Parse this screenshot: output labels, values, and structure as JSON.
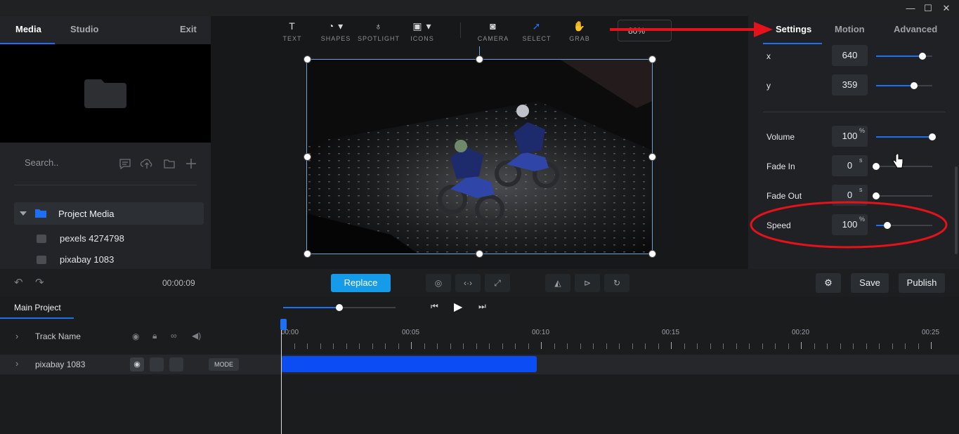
{
  "window": {
    "minimize": "—",
    "maximize": "☐",
    "close": "✕"
  },
  "left_panel": {
    "tabs": [
      "Media",
      "Studio"
    ],
    "exit_label": "Exit",
    "search_placeholder": "Search..",
    "folder_label": "Project Media",
    "media_items": [
      "pexels 4274798",
      "pixabay 1083"
    ],
    "time": "00:00:09"
  },
  "toolbar": {
    "tools": [
      {
        "label": "TEXT",
        "icon": "text-icon"
      },
      {
        "label": "SHAPES",
        "icon": "shapes-icon"
      },
      {
        "label": "SPOTLIGHT",
        "icon": "spotlight-icon"
      },
      {
        "label": "ICONS",
        "icon": "image-icon"
      },
      {
        "label": "CAMERA",
        "icon": "camera-icon"
      },
      {
        "label": "SELECT",
        "icon": "cursor-icon"
      },
      {
        "label": "GRAB",
        "icon": "hand-icon"
      }
    ],
    "zoom": "80%"
  },
  "right_panel": {
    "tabs": [
      "Settings",
      "Motion",
      "Advanced"
    ],
    "active_tab": "Settings",
    "params": [
      {
        "label": "x",
        "value": "640",
        "unit": "",
        "level": 0.82
      },
      {
        "label": "y",
        "value": "359",
        "unit": "",
        "level": 0.68
      },
      {
        "label": "Volume",
        "value": "100",
        "unit": "%",
        "level": 1.0
      },
      {
        "label": "Fade In",
        "value": "0",
        "unit": "s",
        "level": 0.0
      },
      {
        "label": "Fade Out",
        "value": "0",
        "unit": "s",
        "level": 0.0
      },
      {
        "label": "Speed",
        "value": "100",
        "unit": "%",
        "level": 0.2
      }
    ]
  },
  "actions": {
    "replace": "Replace",
    "save": "Save",
    "publish": "Publish"
  },
  "timeline": {
    "project_tab": "Main Project",
    "header_label": "Track Name",
    "track_name": "pixabay 1083",
    "mode_label": "MODE",
    "time_labels": [
      "00:00",
      "00:05",
      "00:10",
      "00:15",
      "00:20",
      "00:25"
    ],
    "zoom_level": 0.5
  },
  "colors": {
    "accent": "#1e6ff2",
    "replace": "#159be8",
    "annotation": "#e3121b"
  }
}
